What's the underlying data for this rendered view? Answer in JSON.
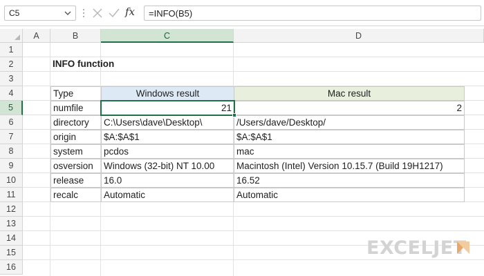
{
  "formula_bar": {
    "name_box": "C5",
    "formula": "=INFO(B5)",
    "fx_label": "fx"
  },
  "columns": [
    "A",
    "B",
    "C",
    "D"
  ],
  "selected_column": "C",
  "rows": [
    "1",
    "2",
    "3",
    "4",
    "5",
    "6",
    "7",
    "8",
    "9",
    "10",
    "11",
    "12",
    "13",
    "14",
    "15",
    "16"
  ],
  "selected_row": "5",
  "sheet": {
    "title": "INFO function",
    "headers": {
      "type": "Type",
      "windows": "Windows result",
      "mac": "Mac result"
    },
    "table": [
      {
        "type": "numfile",
        "windows": "21",
        "mac": "2"
      },
      {
        "type": "directory",
        "windows": "C:\\Users\\dave\\Desktop\\",
        "mac": "/Users/dave/Desktop/"
      },
      {
        "type": "origin",
        "windows": "$A:$A$1",
        "mac": "$A:$A$1"
      },
      {
        "type": "system",
        "windows": "pcdos",
        "mac": "mac"
      },
      {
        "type": "osversion",
        "windows": "Windows (32-bit) NT 10.00",
        "mac": "Macintosh (Intel) Version 10.15.7 (Build 19H1217)"
      },
      {
        "type": "release",
        "windows": "16.0",
        "mac": "16.52"
      },
      {
        "type": "recalc",
        "windows": "Automatic",
        "mac": "Automatic"
      }
    ]
  },
  "watermark": "EXCELJET",
  "colors": {
    "selection": "#1e7145",
    "header_c_fill": "#dde9f5",
    "header_d_fill": "#e8efdc"
  }
}
